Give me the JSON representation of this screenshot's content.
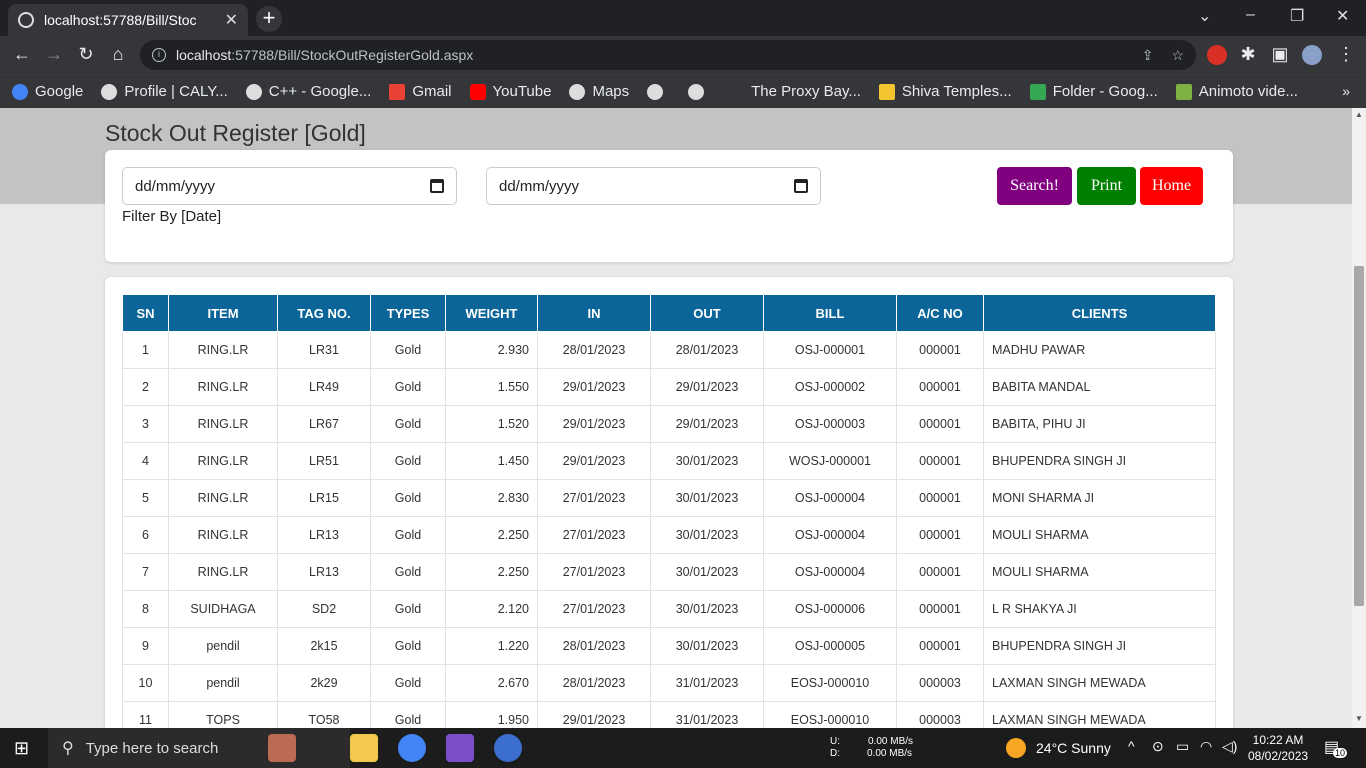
{
  "browser": {
    "tab_title": "localhost:57788/Bill/Stoc",
    "tab_close": "✕",
    "new_tab": "+",
    "url_host": "localhost",
    "url_path": ":57788/Bill/StockOutRegisterGold.aspx",
    "bookmarks": [
      "Google",
      "Profile | CALY...",
      "C++ - Google...",
      "Gmail",
      "YouTube",
      "Maps",
      "",
      "",
      "The Proxy Bay...",
      "Shiva Temples...",
      "Folder - Goog...",
      "Animoto vide..."
    ],
    "bookmarks_more": "»"
  },
  "page": {
    "title": "Stock Out Register [Gold]",
    "date_from_placeholder": "dd/mm/yyyy",
    "date_to_placeholder": "dd/mm/yyyy",
    "filter_label": "Filter By [Date]",
    "buttons": {
      "search": "Search!",
      "print": "Print",
      "home": "Home"
    },
    "colors": {
      "search": "#800080",
      "print": "#008000",
      "home": "#ff0000",
      "table_header": "#0b6599"
    }
  },
  "table": {
    "headers": [
      "SN",
      "ITEM",
      "TAG NO.",
      "TYPES",
      "WEIGHT",
      "IN",
      "OUT",
      "BILL",
      "A/C NO",
      "CLIENTS"
    ],
    "rows": [
      [
        "1",
        "RING.LR",
        "LR31",
        "Gold",
        "2.930",
        "28/01/2023",
        "28/01/2023",
        "OSJ-000001",
        "000001",
        "MADHU PAWAR"
      ],
      [
        "2",
        "RING.LR",
        "LR49",
        "Gold",
        "1.550",
        "29/01/2023",
        "29/01/2023",
        "OSJ-000002",
        "000001",
        "BABITA MANDAL"
      ],
      [
        "3",
        "RING.LR",
        "LR67",
        "Gold",
        "1.520",
        "29/01/2023",
        "29/01/2023",
        "OSJ-000003",
        "000001",
        "BABITA, PIHU JI"
      ],
      [
        "4",
        "RING.LR",
        "LR51",
        "Gold",
        "1.450",
        "29/01/2023",
        "30/01/2023",
        "WOSJ-000001",
        "000001",
        "BHUPENDRA SINGH JI"
      ],
      [
        "5",
        "RING.LR",
        "LR15",
        "Gold",
        "2.830",
        "27/01/2023",
        "30/01/2023",
        "OSJ-000004",
        "000001",
        "MONI SHARMA JI"
      ],
      [
        "6",
        "RING.LR",
        "LR13",
        "Gold",
        "2.250",
        "27/01/2023",
        "30/01/2023",
        "OSJ-000004",
        "000001",
        "MOULI SHARMA"
      ],
      [
        "7",
        "RING.LR",
        "LR13",
        "Gold",
        "2.250",
        "27/01/2023",
        "30/01/2023",
        "OSJ-000004",
        "000001",
        "MOULI SHARMA"
      ],
      [
        "8",
        "SUIDHAGA",
        "SD2",
        "Gold",
        "2.120",
        "27/01/2023",
        "30/01/2023",
        "OSJ-000006",
        "000001",
        "L R SHAKYA JI"
      ],
      [
        "9",
        "pendil",
        "2k15",
        "Gold",
        "1.220",
        "28/01/2023",
        "30/01/2023",
        "OSJ-000005",
        "000001",
        "BHUPENDRA SINGH JI"
      ],
      [
        "10",
        "pendil",
        "2k29",
        "Gold",
        "2.670",
        "28/01/2023",
        "31/01/2023",
        "EOSJ-000010",
        "000003",
        "LAXMAN SINGH MEWADA"
      ],
      [
        "11",
        "TOPS",
        "TO58",
        "Gold",
        "1.950",
        "29/01/2023",
        "31/01/2023",
        "EOSJ-000010",
        "000003",
        "LAXMAN SINGH MEWADA"
      ]
    ]
  },
  "taskbar": {
    "search_placeholder": "Type here to search",
    "net_up": "U:",
    "net_down": "D:",
    "net_up_val": "0.00 MB/s",
    "net_down_val": "0.00 MB/s",
    "weather": "24°C  Sunny",
    "time": "10:22 AM",
    "date": "08/02/2023",
    "notifications": "10"
  }
}
